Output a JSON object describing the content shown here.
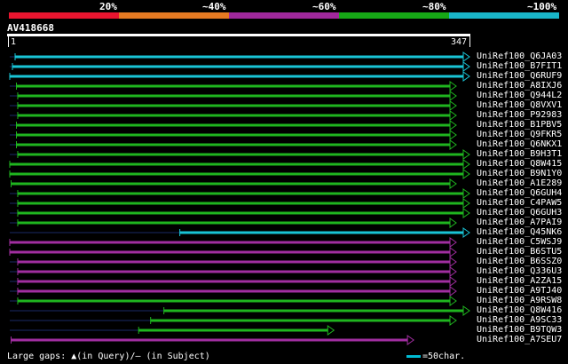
{
  "legend": [
    {
      "label": "20%",
      "color": "#e8152f"
    },
    {
      "label": "~40%",
      "color": "#e57a22"
    },
    {
      "label": "~60%",
      "color": "#a0289c"
    },
    {
      "label": "~80%",
      "color": "#16a816"
    },
    {
      "label": "~100%",
      "color": "#19b6c9"
    }
  ],
  "query": {
    "title": "AV418668",
    "start": "1",
    "end": "347"
  },
  "colors": {
    "cyan": "#19c4d6",
    "green": "#1fb51f",
    "purple": "#a12ea0",
    "dark": "#1a2a66"
  },
  "hits": [
    {
      "name": "UniRef100_Q6JA03",
      "start": 5,
      "end": 347,
      "color": "cyan"
    },
    {
      "name": "UniRef100_B7FIT1",
      "start": 3,
      "end": 347,
      "color": "cyan"
    },
    {
      "name": "UniRef100_Q6RUF9",
      "start": 1,
      "end": 347,
      "color": "cyan"
    },
    {
      "name": "UniRef100_A8IXJ6",
      "start": 6,
      "end": 337,
      "color": "green"
    },
    {
      "name": "UniRef100_Q944L2",
      "start": 7,
      "end": 337,
      "color": "green"
    },
    {
      "name": "UniRef100_Q8VXV1",
      "start": 7,
      "end": 337,
      "color": "green"
    },
    {
      "name": "UniRef100_P92983",
      "start": 7,
      "end": 337,
      "color": "green"
    },
    {
      "name": "UniRef100_B1PBV5",
      "start": 6,
      "end": 337,
      "color": "green"
    },
    {
      "name": "UniRef100_Q9FKR5",
      "start": 6,
      "end": 337,
      "color": "green"
    },
    {
      "name": "UniRef100_Q6NKX1",
      "start": 6,
      "end": 337,
      "color": "green"
    },
    {
      "name": "UniRef100_B9H3T1",
      "start": 7,
      "end": 347,
      "color": "green"
    },
    {
      "name": "UniRef100_Q8W415",
      "start": 1,
      "end": 347,
      "color": "green"
    },
    {
      "name": "UniRef100_B9N1Y0",
      "start": 1,
      "end": 347,
      "color": "green"
    },
    {
      "name": "UniRef100_A1E289",
      "start": 2,
      "end": 337,
      "color": "green"
    },
    {
      "name": "UniRef100_Q6GUH4",
      "start": 7,
      "end": 347,
      "color": "green"
    },
    {
      "name": "UniRef100_C4PAW5",
      "start": 7,
      "end": 347,
      "color": "green"
    },
    {
      "name": "UniRef100_Q6GUH3",
      "start": 7,
      "end": 347,
      "color": "green"
    },
    {
      "name": "UniRef100_A7PAI9",
      "start": 7,
      "end": 337,
      "color": "green"
    },
    {
      "name": "UniRef100_Q45NK6",
      "start": 129,
      "end": 347,
      "color": "cyan"
    },
    {
      "name": "UniRef100_C5WSJ9",
      "start": 1,
      "end": 337,
      "color": "purple"
    },
    {
      "name": "UniRef100_B6STU5",
      "start": 1,
      "end": 337,
      "color": "purple"
    },
    {
      "name": "UniRef100_B6SSZ0",
      "start": 7,
      "end": 337,
      "color": "purple"
    },
    {
      "name": "UniRef100_Q336U3",
      "start": 7,
      "end": 337,
      "color": "purple"
    },
    {
      "name": "UniRef100_A2ZA15",
      "start": 7,
      "end": 337,
      "color": "purple"
    },
    {
      "name": "UniRef100_A9TJ40",
      "start": 7,
      "end": 337,
      "color": "purple"
    },
    {
      "name": "UniRef100_A9RSW8",
      "start": 7,
      "end": 337,
      "color": "green"
    },
    {
      "name": "UniRef100_Q8W416",
      "start": 117,
      "end": 347,
      "color": "green"
    },
    {
      "name": "UniRef100_A9SC33",
      "start": 107,
      "end": 337,
      "color": "green"
    },
    {
      "name": "UniRef100_B9TQW3",
      "start": 98,
      "end": 245,
      "color": "green"
    },
    {
      "name": "UniRef100_A7SEU7",
      "start": 2,
      "end": 305,
      "color": "purple"
    }
  ],
  "footer": {
    "gaps": "Large gaps: ▲(in Query)/– (in Subject)",
    "scale": "=50char."
  }
}
